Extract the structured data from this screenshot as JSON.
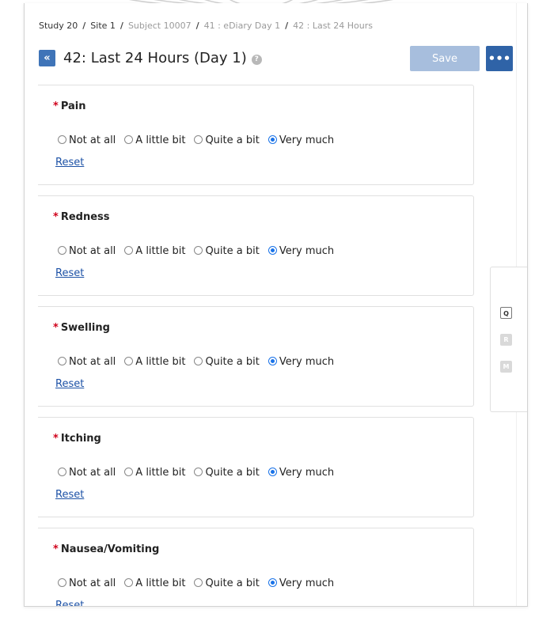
{
  "breadcrumb": [
    {
      "label": "Study 20",
      "muted": false
    },
    {
      "label": "Site 1",
      "muted": false
    },
    {
      "label": "Subject 10007",
      "muted": true
    },
    {
      "label": "41 : eDiary Day 1",
      "muted": true
    },
    {
      "label": "42 : Last 24 Hours",
      "muted": true
    }
  ],
  "header": {
    "back_label": "«",
    "title": "42: Last 24 Hours (Day 1)",
    "help_glyph": "?",
    "save_label": "Save",
    "more_label": "•••"
  },
  "questions": [
    {
      "label": "Pain",
      "required": true,
      "selected": "Very much"
    },
    {
      "label": "Redness",
      "required": true,
      "selected": "Very much"
    },
    {
      "label": "Swelling",
      "required": true,
      "selected": "Very much"
    },
    {
      "label": "Itching",
      "required": true,
      "selected": "Very much"
    },
    {
      "label": "Nausea/Vomiting",
      "required": true,
      "selected": "Very much"
    }
  ],
  "options": [
    "Not at all",
    "A little bit",
    "Quite a bit",
    "Very much"
  ],
  "reset_label": "Reset",
  "side_rail": {
    "q": "Q",
    "r": "R",
    "m": "M"
  },
  "colors": {
    "accent": "#2f63a7",
    "save_disabled": "#a7bedd",
    "required": "#d0021b",
    "link": "#1d52a6"
  }
}
